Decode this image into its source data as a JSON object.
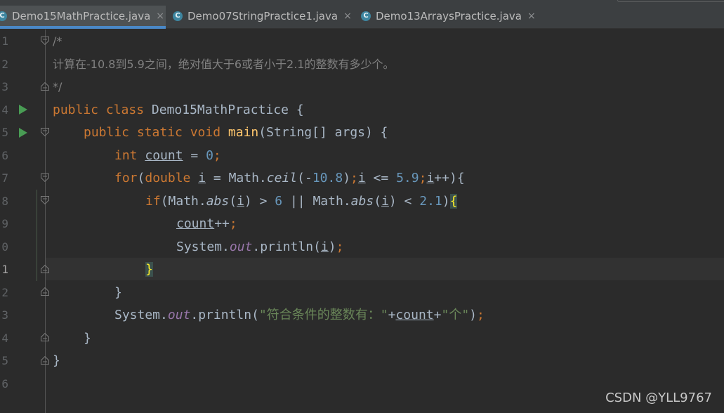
{
  "tabs": [
    {
      "label": "Demo15MathPractice.java",
      "icon": "C",
      "active": true
    },
    {
      "label": "Demo07StringPractice1.java",
      "icon": "C",
      "active": false
    },
    {
      "label": "Demo13ArraysPractice.java",
      "icon": "C",
      "active": false
    }
  ],
  "close_glyph": "×",
  "line_numbers": [
    "1",
    "2",
    "3",
    "4",
    "5",
    "6",
    "7",
    "8",
    "9",
    "0",
    "1",
    "2",
    "3",
    "4",
    "5",
    "6"
  ],
  "code": {
    "l1": "/*",
    "l2": "计算在-10.8到5.9之间，绝对值大于6或者小于2.1的整数有多少个。",
    "l3": "*/",
    "l4_kw": "public class",
    "l4_rest": " Demo15MathPractice {",
    "l5_kw": "public static void",
    "l5_fn": "main",
    "l5_rest": "(String[] args) {",
    "l6_kw": "int",
    "l6_var": "count",
    "l6_eq": " = ",
    "l6_num": "0",
    "l6_semi": ";",
    "l7_kw1": "for",
    "l7_p1": "(",
    "l7_kw2": "double",
    "l7_sp": " ",
    "l7_i1": "i",
    "l7_eq": " = Math.",
    "l7_ceil": "ceil",
    "l7_p2": "(-",
    "l7_n1": "10.8",
    "l7_p3": ")",
    "l7_semi1": ";",
    "l7_i2": "i",
    "l7_le": " <= ",
    "l7_n2": "5.9",
    "l7_semi2": ";",
    "l7_i3": "i",
    "l7_end": "++){",
    "l8_kw": "if",
    "l8_a": "(Math.",
    "l8_abs1": "abs",
    "l8_b": "(",
    "l8_i1": "i",
    "l8_c": ") > ",
    "l8_n1": "6",
    "l8_d": " || Math.",
    "l8_abs2": "abs",
    "l8_e": "(",
    "l8_i2": "i",
    "l8_f": ") < ",
    "l8_n2": "2.1",
    "l8_g": ")",
    "l8_brace": "{",
    "l9_var": "count",
    "l9_op": "++",
    "l9_semi": ";",
    "l10_a": "System.",
    "l10_out": "out",
    "l10_b": ".println(",
    "l10_i": "i",
    "l10_c": ")",
    "l10_semi": ";",
    "l11_brace": "}",
    "l12": "}",
    "l13_a": "System.",
    "l13_out": "out",
    "l13_b": ".println(",
    "l13_s1": "\"符合条件的整数有：\"",
    "l13_plus1": "+",
    "l13_var": "count",
    "l13_plus2": "+",
    "l13_s2": "\"个\"",
    "l13_c": ")",
    "l13_semi": ";",
    "l14": "}",
    "l15": "}"
  },
  "watermark": "CSDN @YLL9767",
  "colors": {
    "background": "#2b2b2b",
    "keyword": "#cc7832",
    "string": "#6a8759",
    "number": "#6897bb",
    "method": "#ffc66d",
    "field": "#9876aa",
    "comment": "#808080",
    "run_icon": "#499c54"
  }
}
